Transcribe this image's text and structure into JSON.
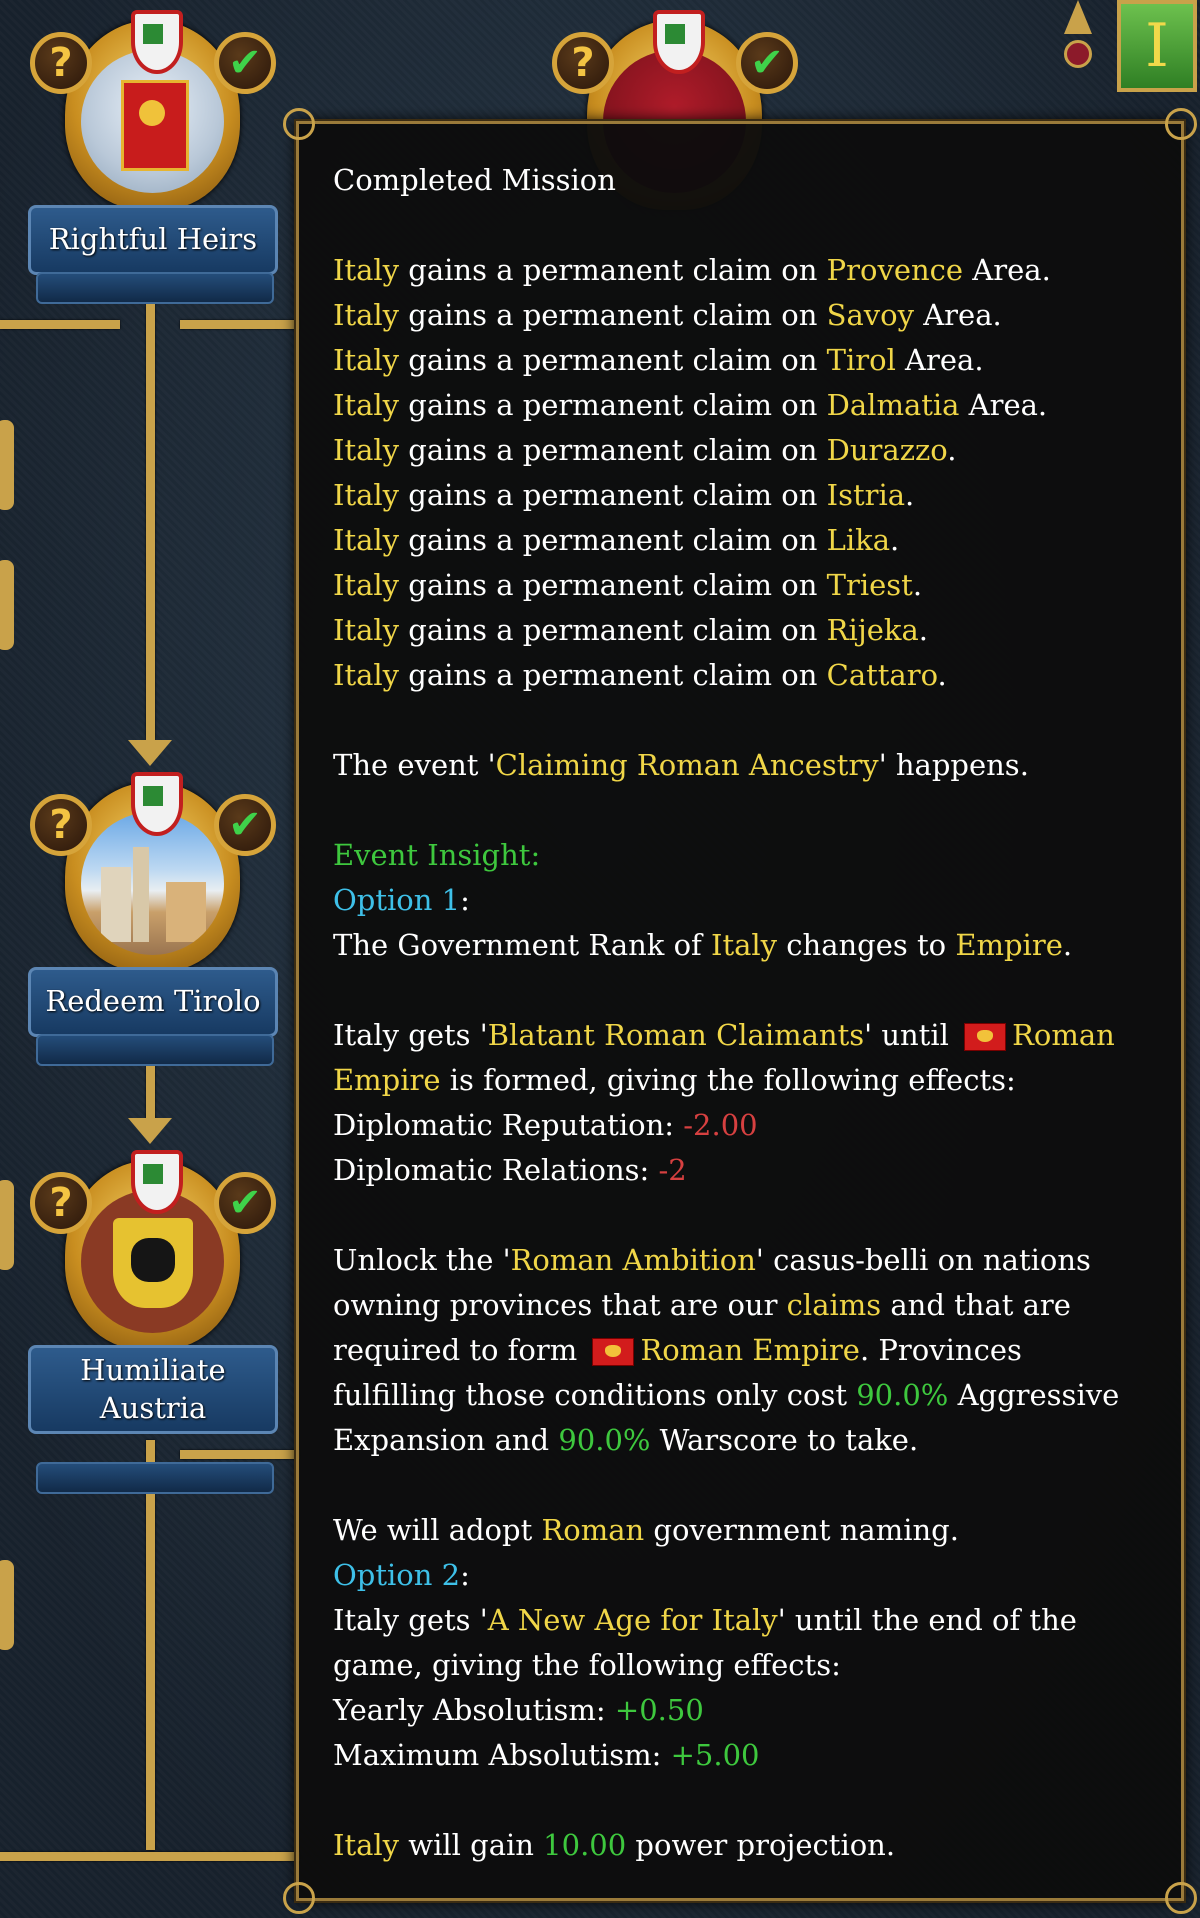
{
  "missions": {
    "rightful_heirs": {
      "label": "Rightful Heirs"
    },
    "a_worthy_navy": {
      "label": ""
    },
    "redeem_tirolo": {
      "label": "Redeem Tirolo"
    },
    "humiliate_austria": {
      "line1": "Humiliate",
      "line2": "Austria"
    }
  },
  "topbar": {
    "ideas_letter": "I"
  },
  "icons": {
    "question": "?",
    "check": "✔"
  },
  "tooltip": {
    "title": "Completed Mission",
    "country": "Italy",
    "claim_text": "gains a permanent claim on",
    "area": "Area.",
    "claims": [
      {
        "place": "Provence",
        "suffix": " Area."
      },
      {
        "place": "Savoy",
        "suffix": " Area."
      },
      {
        "place": "Tirol",
        "suffix": " Area."
      },
      {
        "place": "Dalmatia",
        "suffix": " Area."
      },
      {
        "place": "Durazzo",
        "suffix": "."
      },
      {
        "place": "Istria",
        "suffix": "."
      },
      {
        "place": "Lika",
        "suffix": "."
      },
      {
        "place": "Triest",
        "suffix": "."
      },
      {
        "place": "Rijeka",
        "suffix": "."
      },
      {
        "place": "Cattaro",
        "suffix": "."
      }
    ],
    "event": {
      "pre": "The event '",
      "name": "Claiming Roman Ancestry",
      "post": "' happens."
    },
    "insight": "Event Insight:",
    "option1": {
      "label": "Option 1",
      "rank_pre": "The Government Rank of ",
      "rank_country": "Italy",
      "rank_mid": " changes to ",
      "rank_value": "Empire",
      "mod_pre": "Italy gets '",
      "mod_name": "Blatant Roman Claimants",
      "mod_mid": "' until ",
      "mod_target_a": "Roman",
      "mod_target_b": "Empire",
      "mod_post": " is formed, giving the following effects:",
      "effect1_label": "Diplomatic Reputation: ",
      "effect1_value": "-2.00",
      "effect2_label": "Diplomatic Relations: ",
      "effect2_value": "-2",
      "cb_pre": "Unlock the '",
      "cb_name": "Roman Ambition",
      "cb_mid1": "' casus-belli on nations owning provinces that are our ",
      "cb_claims": "claims",
      "cb_mid2": " and that are required to form ",
      "cb_target": "Roman Empire",
      "cb_mid3": ". Provinces fulfilling those conditions only cost ",
      "cb_ae": "90.0%",
      "cb_mid4": " Aggressive Expansion and ",
      "cb_ws": "90.0%",
      "cb_post": " Warscore to take.",
      "naming_pre": "We will adopt ",
      "naming_value": "Roman",
      "naming_post": " government naming."
    },
    "option2": {
      "label": "Option 2",
      "mod_pre": "Italy gets '",
      "mod_name": "A New Age for Italy",
      "mod_post": "' until the end of the game, giving the following effects:",
      "effect1_label": "Yearly Absolutism: ",
      "effect1_value": "+0.50",
      "effect2_label": "Maximum Absolutism: ",
      "effect2_value": "+5.00"
    },
    "power": {
      "country": "Italy",
      "pre": " will gain ",
      "value": "10.00",
      "post": " power projection."
    }
  },
  "colors": {
    "highlight": "#f0d648",
    "positive": "#3ec83e",
    "negative": "#d64040",
    "option": "#3ec0e8"
  }
}
